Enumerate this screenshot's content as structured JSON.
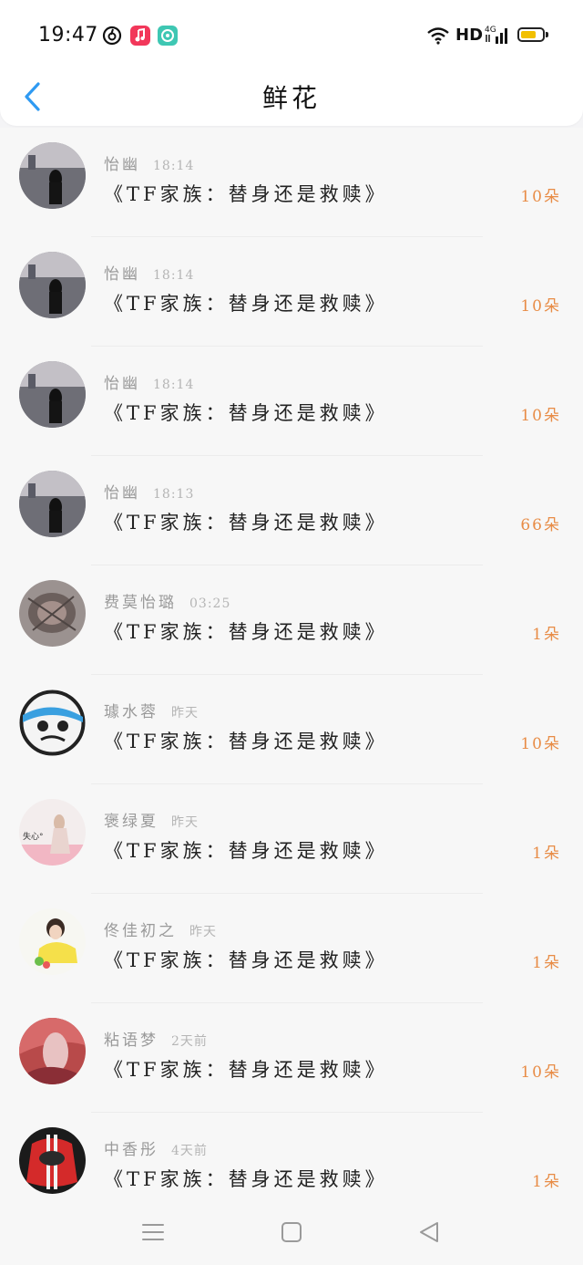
{
  "status_bar": {
    "time": "19:47",
    "network": "HD",
    "signal_label": "4G",
    "battery_level": 0.65,
    "icons": [
      "netease-music-icon",
      "music-icon",
      "mini-program-icon",
      "wifi-icon",
      "signal-icon",
      "battery-icon"
    ]
  },
  "header": {
    "title": "鲜花",
    "back_icon": "chevron-left-icon"
  },
  "colors": {
    "accent_blue": "#2f9af2",
    "amount_orange": "#e88c46",
    "name_gray": "#9a9a9a",
    "time_gray": "#b5b5b5"
  },
  "entries": [
    {
      "name": "怡幽",
      "time": "18:14",
      "book": "《TF家族：替身还是救赎》",
      "amount": "10朵"
    },
    {
      "name": "怡幽",
      "time": "18:14",
      "book": "《TF家族：替身还是救赎》",
      "amount": "10朵"
    },
    {
      "name": "怡幽",
      "time": "18:14",
      "book": "《TF家族：替身还是救赎》",
      "amount": "10朵"
    },
    {
      "name": "怡幽",
      "time": "18:13",
      "book": "《TF家族：替身还是救赎》",
      "amount": "66朵"
    },
    {
      "name": "费莫怡璐",
      "time": "03:25",
      "book": "《TF家族：替身还是救赎》",
      "amount": "1朵"
    },
    {
      "name": "璩水蓉",
      "time": "昨天",
      "book": "《TF家族：替身还是救赎》",
      "amount": "10朵"
    },
    {
      "name": "褒绿夏",
      "time": "昨天",
      "book": "《TF家族：替身还是救赎》",
      "amount": "1朵",
      "avatar_text": "失心°"
    },
    {
      "name": "佟佳初之",
      "time": "昨天",
      "book": "《TF家族：替身还是救赎》",
      "amount": "1朵"
    },
    {
      "name": "粘语梦",
      "time": "2天前",
      "book": "《TF家族：替身还是救赎》",
      "amount": "10朵"
    },
    {
      "name": "中香彤",
      "time": "4天前",
      "book": "《TF家族：替身还是救赎》",
      "amount": "1朵"
    }
  ],
  "navbar": {
    "buttons": [
      "menu-icon",
      "home-icon",
      "back-triangle-icon"
    ]
  }
}
